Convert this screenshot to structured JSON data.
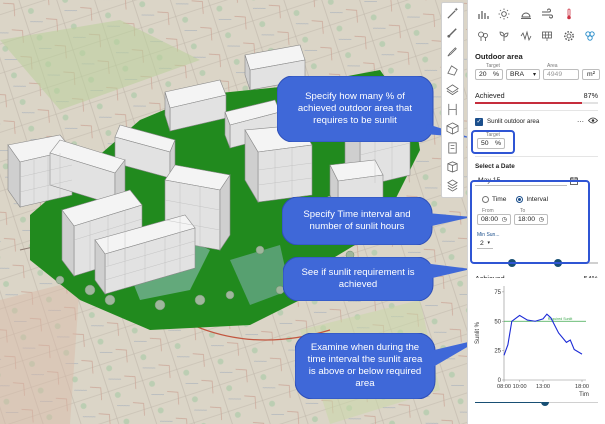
{
  "panel": {
    "section_title": "Outdoor area",
    "target_label": "Target",
    "area_label": "Area",
    "target_value": "20",
    "target_unit": "%",
    "basis_value": "BRA",
    "area_value": "4949",
    "area_unit": "m²",
    "achieved_label": "Achieved",
    "achieved_value": "87%",
    "achieved_fraction": 0.87,
    "sunlit_label": "Sunlit outdoor area",
    "sunlit_target_label": "Target",
    "sunlit_target_value": "50",
    "sunlit_target_unit": "%",
    "date_section": "Select a Date",
    "date_value": "May 15",
    "mode_time": "Time",
    "mode_interval": "Interval",
    "from_label": "From",
    "to_label": "To",
    "from_value": "08:00",
    "to_value": "18:00",
    "min_sun_label": "Min Sun...",
    "min_sun_value": "2",
    "achieved2_label": "Achieved",
    "achieved2_value": "54%",
    "achieved2_fraction": 0.54
  },
  "callouts": {
    "c1": "Specify how many % of achieved outdoor area that requires to be sunlit",
    "c2": "Specify Time interval and number of sunlit hours",
    "c3": "See if sunlit requirement is achieved",
    "c4": "Examine when during the time interval the sunlit area is above or below required area"
  },
  "chart_data": {
    "type": "line",
    "ylabel": "Sunlit %",
    "xlabel": "Tim",
    "x_ticks": [
      "08:00",
      "10:00",
      "13:00",
      "18:00"
    ],
    "y_ticks": [
      "0",
      "25",
      "50",
      "75"
    ],
    "ylim": [
      0,
      80
    ],
    "xlim": [
      8,
      18
    ],
    "target_line": 50,
    "target_label": "Required Sunlit",
    "series": [
      {
        "x": [
          8.0,
          8.5,
          9.0,
          10.0,
          11.0,
          12.0,
          13.0,
          13.5,
          14.0,
          15.0,
          16.0,
          16.5,
          17.0,
          18.0
        ],
        "y": [
          21,
          30,
          50,
          55,
          51,
          50,
          52,
          56,
          53,
          40,
          32,
          34,
          26,
          22
        ]
      }
    ],
    "colors": {
      "line": "#1c2bd6",
      "target": "#3aa64a"
    }
  },
  "colors": {
    "accent": "#2f55d4",
    "callout": "#3f68d8",
    "progress": "#c62d3c",
    "slider": "#184f74"
  }
}
